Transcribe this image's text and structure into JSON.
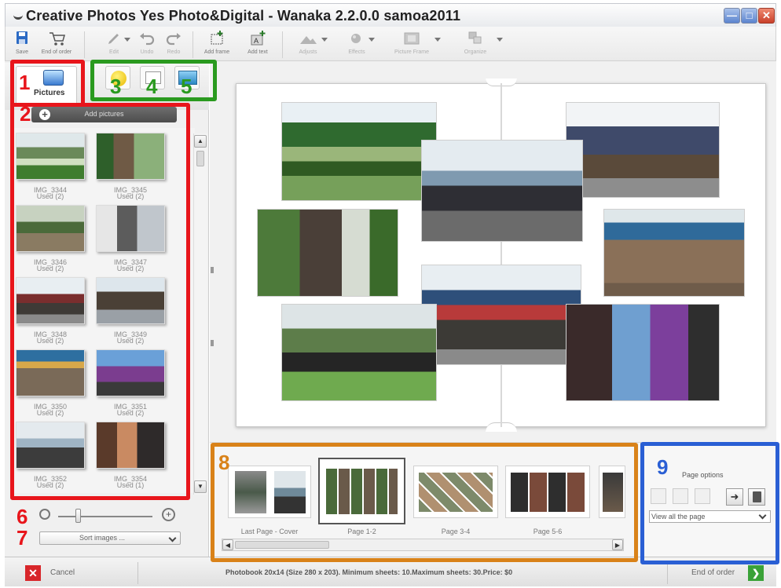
{
  "window": {
    "title": "Creative Photos Yes Photo&Digital - Wanaka 2.2.0.0 samoa2011",
    "controls": [
      "minimize",
      "maximize",
      "close"
    ]
  },
  "toolbar": {
    "items": [
      {
        "label": "Save",
        "icon": "save-icon",
        "enabled": true
      },
      {
        "label": "End of order",
        "icon": "cart-icon",
        "enabled": true
      },
      {
        "label": "Edit",
        "icon": "pencil-icon",
        "enabled": false
      },
      {
        "label": "Undo",
        "icon": "undo-icon",
        "enabled": false
      },
      {
        "label": "Redo",
        "icon": "redo-icon",
        "enabled": false
      },
      {
        "label": "Add frame",
        "icon": "add-frame-icon",
        "enabled": true
      },
      {
        "label": "Add text",
        "icon": "add-text-icon",
        "enabled": true
      },
      {
        "label": "Adjusts",
        "icon": "adjusts-icon",
        "enabled": false
      },
      {
        "label": "Effects",
        "icon": "effects-icon",
        "enabled": false
      },
      {
        "label": "Picture Frame",
        "icon": "picture-frame-icon",
        "enabled": false
      },
      {
        "label": "Organize",
        "icon": "organize-icon",
        "enabled": false
      }
    ]
  },
  "left_panel": {
    "active_tab": "Pictures",
    "add_pictures_label": "Add pictures",
    "thumbnails": [
      {
        "name": "IMG_3344",
        "status": "Used (2)"
      },
      {
        "name": "IMG_3345",
        "status": "Used (2)"
      },
      {
        "name": "IMG_3346",
        "status": "Used (2)"
      },
      {
        "name": "IMG_3347",
        "status": "Used (2)"
      },
      {
        "name": "IMG_3348",
        "status": "Used (2)"
      },
      {
        "name": "IMG_3349",
        "status": "Used (2)"
      },
      {
        "name": "IMG_3350",
        "status": "Used (2)"
      },
      {
        "name": "IMG_3351",
        "status": "Used (2)"
      },
      {
        "name": "IMG_3352",
        "status": "Used (2)"
      },
      {
        "name": "IMG_3354",
        "status": "Used (1)"
      }
    ],
    "sort_label": "Sort images ..."
  },
  "page_strip": {
    "pages": [
      {
        "label": "Last Page - Cover",
        "selected": false
      },
      {
        "label": "Page 1-2",
        "selected": true
      },
      {
        "label": "Page 3-4",
        "selected": false
      },
      {
        "label": "Page 5-6",
        "selected": false
      }
    ]
  },
  "page_options": {
    "title": "Page options",
    "view_select": "View all the page"
  },
  "bottom_bar": {
    "cancel_label": "Cancel",
    "info": "Photobook 20x14 (Size 280 x 203). Minimum sheets: 10.Maximum sheets: 30.Price: $0",
    "end_label": "End of order"
  },
  "callouts": [
    {
      "number": "1",
      "color": "#e8151b"
    },
    {
      "number": "2",
      "color": "#e8151b"
    },
    {
      "number": "3",
      "color": "#2a9a1f"
    },
    {
      "number": "4",
      "color": "#2a9a1f"
    },
    {
      "number": "5",
      "color": "#2a9a1f"
    },
    {
      "number": "6",
      "color": "#e8151b"
    },
    {
      "number": "7",
      "color": "#e8151b"
    },
    {
      "number": "8",
      "color": "#d98219"
    },
    {
      "number": "9",
      "color": "#2a5fd4"
    }
  ]
}
